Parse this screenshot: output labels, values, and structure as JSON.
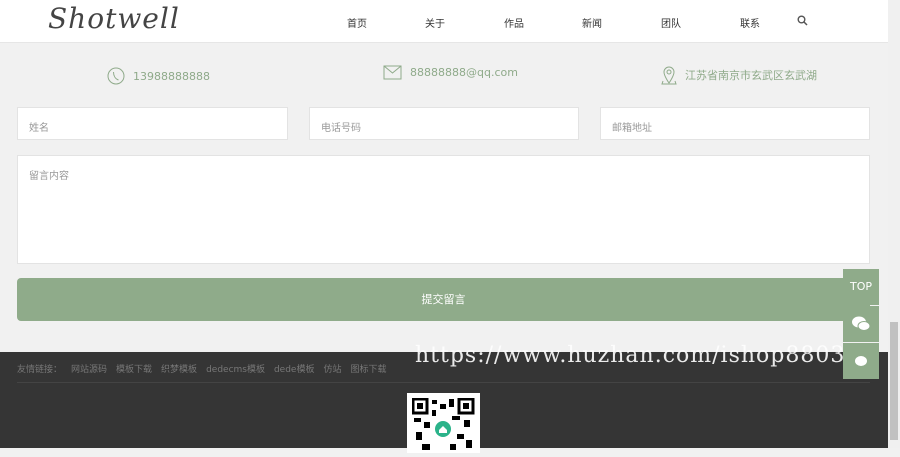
{
  "header": {
    "logo": "Shotwell",
    "nav": [
      "首页",
      "关于",
      "作品",
      "新闻",
      "团队",
      "联系"
    ]
  },
  "contact": {
    "phone": "13988888888",
    "email": "88888888@qq.com",
    "address": "江苏省南京市玄武区玄武湖"
  },
  "form": {
    "name_placeholder": "姓名",
    "phone_placeholder": "电话号码",
    "email_placeholder": "邮箱地址",
    "message_placeholder": "留言内容",
    "submit": "提交留言"
  },
  "footer": {
    "links_label": "友情链接：",
    "links": [
      "网站源码",
      "模板下载",
      "织梦模板",
      "dedecms模板",
      "dede模板",
      "仿站",
      "图标下载"
    ]
  },
  "side": {
    "top": "TOP"
  },
  "watermark": "https://www.huzhan.com/ishop8803"
}
